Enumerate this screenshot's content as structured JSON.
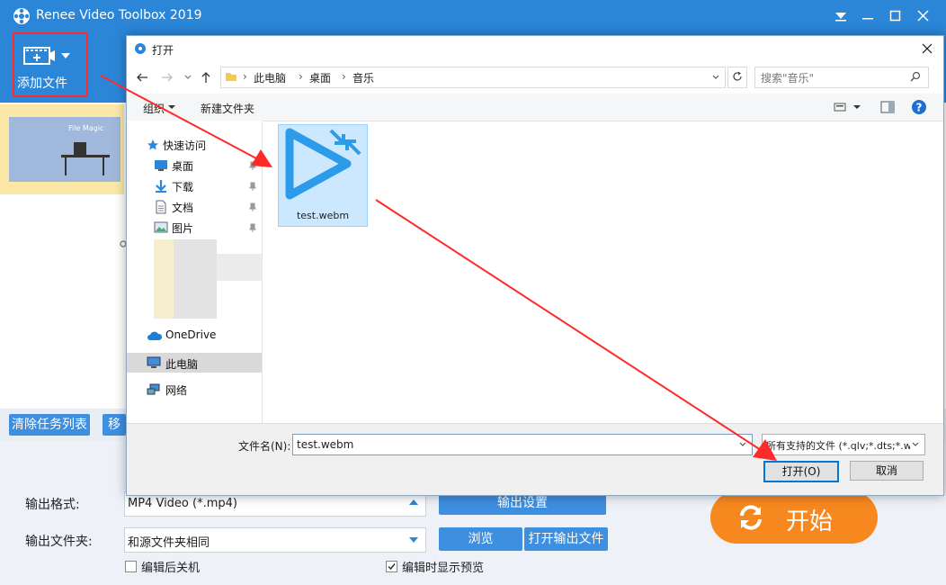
{
  "app": {
    "title": "Renee Video Toolbox 2019",
    "add_file_label": "添加文件",
    "clear_tasks_label": "清除任务列表",
    "move_label_partial": "移",
    "output_format_label": "输出格式:",
    "output_format_value": "MP4 Video (*.mp4)",
    "output_settings_label": "输出设置",
    "output_folder_label": "输出文件夹:",
    "output_folder_value": "和源文件夹相同",
    "browse_label": "浏览",
    "open_output_label": "打开输出文件",
    "shutdown_after_edit_label": "编辑后关机",
    "shutdown_after_edit_checked": false,
    "show_preview_label": "编辑时显示预览",
    "show_preview_checked": true,
    "start_label": "开始",
    "thumbnail_text": "File Magic"
  },
  "dialog": {
    "title": "打开",
    "breadcrumb": [
      "此电脑",
      "桌面",
      "音乐"
    ],
    "search_placeholder": "搜索\"音乐\"",
    "organize_label": "组织",
    "new_folder_label": "新建文件夹",
    "nav": {
      "quick_access": "快速访问",
      "desktop": "桌面",
      "downloads": "下载",
      "documents": "文档",
      "pictures": "图片",
      "onedrive": "OneDrive",
      "this_pc": "此电脑",
      "network": "网络"
    },
    "file_name": "test.webm",
    "filename_label": "文件名(N):",
    "filename_value": "test.webm",
    "filetype_value": "所有支持的文件 (*.qlv;*.dts;*.w",
    "open_button": "打开(O)",
    "cancel_button": "取消"
  },
  "colors": {
    "accent": "#2b86d8",
    "start": "#f7881f",
    "annotation": "#ff2a2a"
  }
}
